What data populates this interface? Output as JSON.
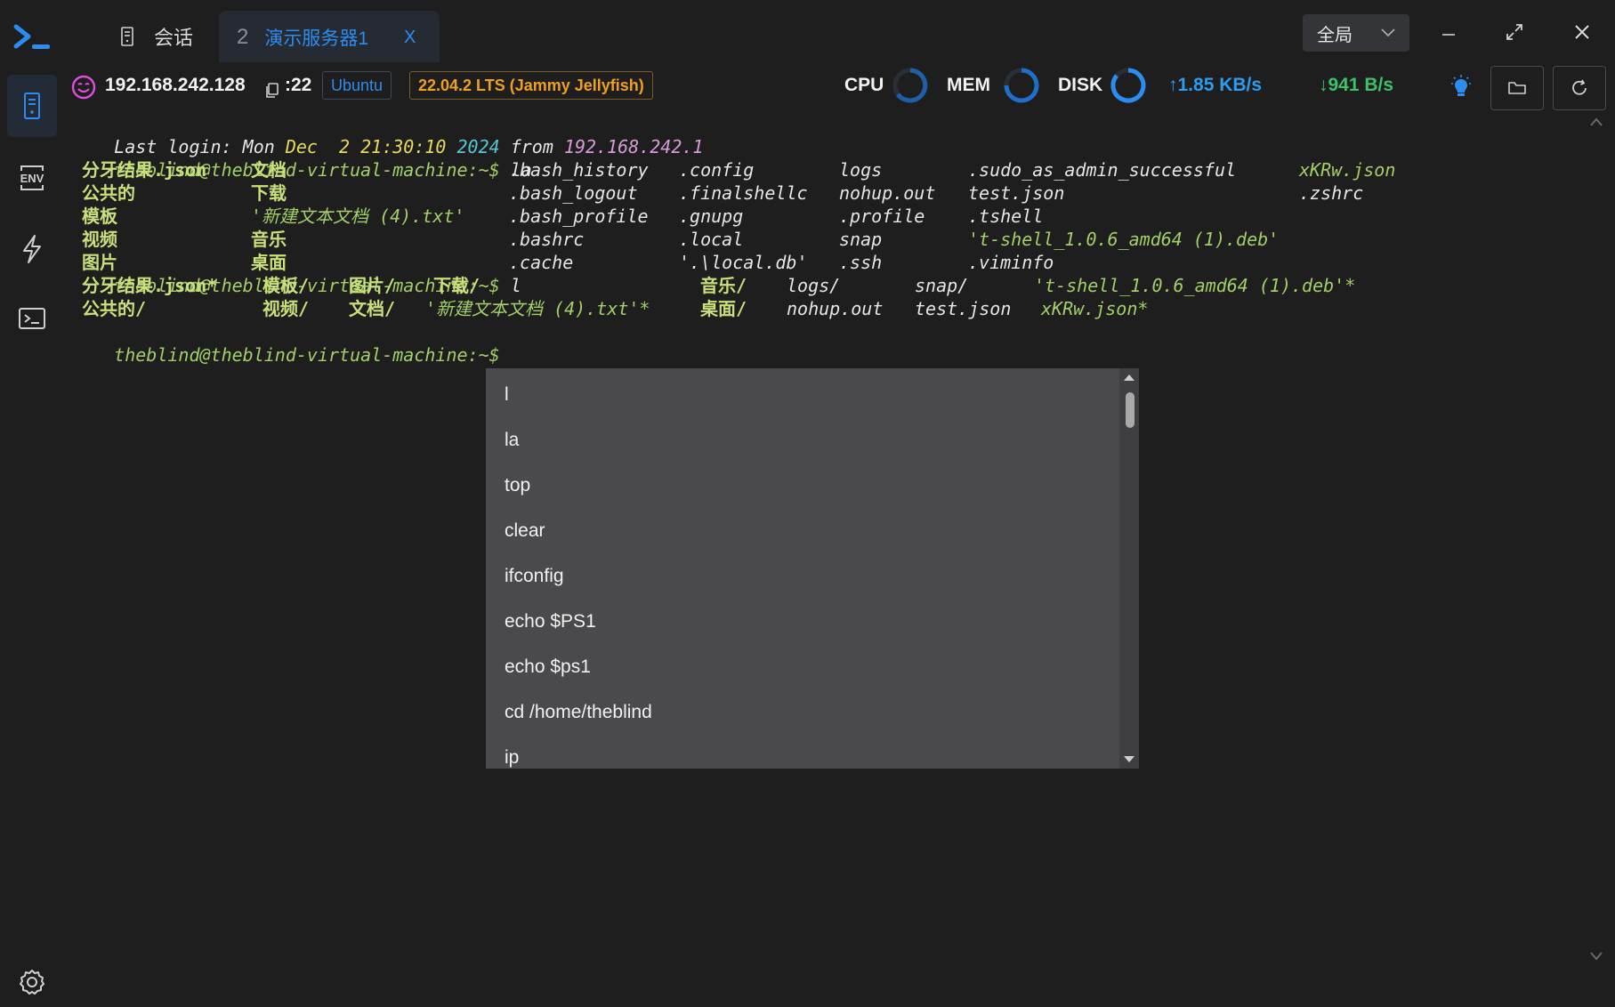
{
  "titlebar": {
    "sessions_label": "会话",
    "tab": {
      "number": "2",
      "label": "演示服务器1",
      "close": "X"
    },
    "scope_select": "全局"
  },
  "infobar": {
    "ip": "192.168.242.128",
    "port": ":22",
    "os_name": "Ubuntu",
    "os_version": "22.04.2 LTS (Jammy Jellyfish)",
    "cpu_label": "CPU",
    "mem_label": "MEM",
    "disk_label": "DISK",
    "upload": "↑1.85 KB/s",
    "download": "↓941 B/s"
  },
  "terminal": {
    "last_login": {
      "prefix": "Last login: Mon ",
      "month": "Dec",
      "day": "  2",
      "time": "21:30:10",
      "year": "2024",
      "from": "from",
      "ip": "192.168.242.1"
    },
    "prompt": "theblind@theblind-virtual-machine:~$",
    "cmd1": " la",
    "cmd2": " l",
    "la_output": {
      "col1": [
        "分牙结果.json",
        "公共的",
        "模板",
        "视频",
        "图片"
      ],
      "col2": [
        "文档",
        "下载",
        "'新建文本文档 (4).txt'",
        "音乐",
        "桌面"
      ],
      "col3": [
        ".bash_history",
        ".bash_logout",
        ".bash_profile",
        ".bashrc",
        ".cache"
      ],
      "col4": [
        ".config",
        ".finalshellc",
        ".gnupg",
        ".local",
        "'.\\local.db'"
      ],
      "col5": [
        "logs",
        "nohup.out",
        ".profile",
        "snap",
        ".ssh"
      ],
      "col6": [
        ".sudo_as_admin_successful",
        "test.json",
        ".tshell",
        "'t-shell_1.0.6_amd64 (1).deb'",
        ".viminfo"
      ],
      "col7": [
        "xKRw.json",
        ".zshrc"
      ]
    },
    "l_output": {
      "row1": [
        "分牙结果.json*",
        "模板/",
        "图片/",
        "下载/",
        "音乐/",
        "logs/",
        "snap/",
        "'t-shell_1.0.6_amd64 (1).deb'*"
      ],
      "row2": [
        "公共的/",
        "视频/",
        "文档/",
        "'新建文本文档 (4).txt'*",
        "桌面/",
        "nohup.out",
        "test.json",
        "xKRw.json*"
      ]
    }
  },
  "history_dropdown": {
    "items": [
      "l",
      "la",
      "top",
      "clear",
      "ifconfig",
      "echo $PS1",
      "echo $ps1",
      "cd /home/theblind",
      "ip"
    ]
  },
  "colors": {
    "accent": "#2d8cf0",
    "background": "#1e1e1e",
    "dropdown": "#4a4a4d",
    "prompt_green": "#a2cf68",
    "warning_orange": "#f0a020"
  },
  "icons": [
    "terminal-logo-icon",
    "server-icon",
    "env-icon",
    "lightning-icon",
    "console-icon",
    "settings-icon",
    "lightbulb-icon",
    "folder-icon",
    "refresh-icon"
  ]
}
